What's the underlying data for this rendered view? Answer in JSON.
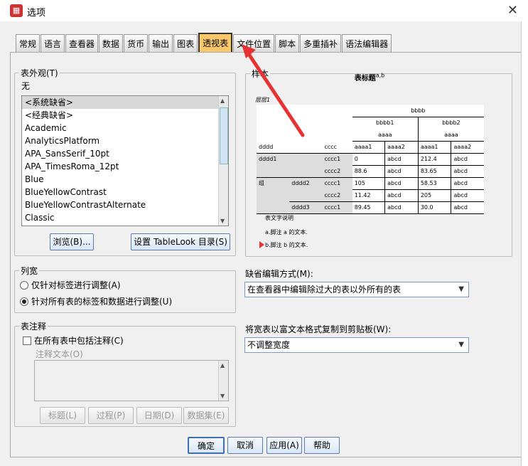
{
  "window": {
    "title": "选项",
    "close": "✕"
  },
  "tabs": [
    "常规",
    "语言",
    "查看器",
    "数据",
    "货币",
    "输出",
    "图表",
    "透视表",
    "文件位置",
    "脚本",
    "多重插补",
    "语法编辑器"
  ],
  "active_tab": "透视表",
  "table_look": {
    "legend": "表外观(T)",
    "current": "无",
    "items": [
      "<系统缺省>",
      "<经典缺省>",
      "Academic",
      "AnalyticsPlatform",
      "APA_SansSerif_10pt",
      "APA_TimesRoma_12pt",
      "Blue",
      "BlueYellowContrast",
      "BlueYellowContrastAlternate",
      "Classic"
    ],
    "browse": "浏览(B)...",
    "set_dir": "设置 TableLook 目录(S)"
  },
  "column_width": {
    "legend": "列宽",
    "opt1": "仅针对标签进行调整(A)",
    "opt2": "针对所有表的标签和数据进行调整(U)"
  },
  "notes": {
    "legend": "表注释",
    "include": "在所有表中包括注释(C)",
    "text_label": "注释文本(O)",
    "buttons": [
      "标题(L)",
      "过程(P)",
      "日期(D)",
      "数据集(E)"
    ]
  },
  "sample": {
    "legend": "样本",
    "title": "表标题",
    "title_sup": "a,b",
    "layer": "层层1",
    "col_top": "bbbb",
    "col_b1": "bbbb1",
    "col_b2": "bbbb2",
    "aaaa1": "aaaa",
    "aaaa2": "aaaa",
    "dddd": "dddd",
    "cccc": "cccc",
    "sub": [
      "aaaa1",
      "aaaa2",
      "aaaa1",
      "aaaa2"
    ],
    "rows": [
      {
        "r1": "dddd1",
        "r2": "",
        "c": "cccc1",
        "v": [
          "0",
          "abcd",
          "212.4",
          "abcd"
        ]
      },
      {
        "r1": "",
        "r2": "",
        "c": "cccc2",
        "v": [
          "88.6",
          "abcd",
          "83.65",
          "abcd"
        ]
      },
      {
        "r1": "组",
        "r2": "dddd2",
        "c": "cccc1",
        "v": [
          "105",
          "abcd",
          "58.53",
          "abcd"
        ]
      },
      {
        "r1": "",
        "r2": "",
        "c": "cccc2",
        "v": [
          "11.42",
          "abcd",
          "205",
          "abcd"
        ]
      },
      {
        "r1": "",
        "r2": "dddd3",
        "c": "cccc1",
        "v": [
          "89.45",
          "abcd",
          "30.0",
          "abcd"
        ]
      }
    ],
    "caption": "表文字说明",
    "fn_a": "a.脚注 a 的文本.",
    "fn_b": "b.脚注 b 的文本."
  },
  "edit_mode": {
    "label": "缺省编辑方式(M):",
    "value": "在查看器中编辑除过大的表以外所有的表"
  },
  "copy_wide": {
    "label": "将宽表以富文本格式复制到剪贴板(W):",
    "value": "不调整宽度"
  },
  "footer": {
    "ok": "确定",
    "cancel": "取消",
    "apply": "应用(A)",
    "help": "帮助"
  },
  "colors": {
    "active_tab": "#f8c86a",
    "arrow": "#e63232"
  }
}
